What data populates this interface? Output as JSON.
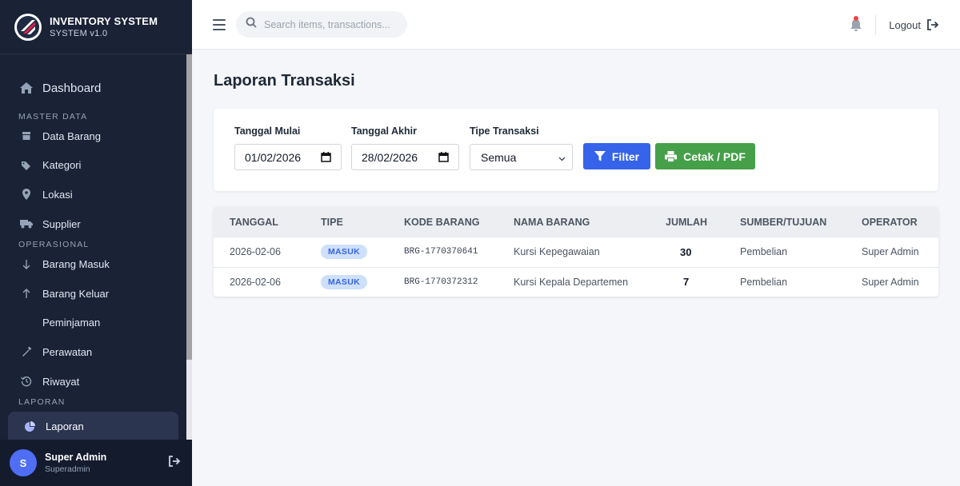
{
  "brand": {
    "title": "INVENTORY SYSTEM",
    "subtitle": "SYSTEM v1.0"
  },
  "sidebar": {
    "dashboard": "Dashboard",
    "section_master": "MASTER DATA",
    "master_items": [
      "Data Barang",
      "Kategori",
      "Lokasi",
      "Supplier"
    ],
    "section_operasional": "OPERASIONAL",
    "operasional_items": [
      "Barang Masuk",
      "Barang Keluar",
      "Peminjaman",
      "Perawatan",
      "Riwayat"
    ],
    "section_laporan": "LAPORAN",
    "active_item": "Laporan"
  },
  "user": {
    "initial": "S",
    "name": "Super Admin",
    "role": "Superadmin"
  },
  "topbar": {
    "search_placeholder": "Search items, transactions...",
    "logout_label": "Logout"
  },
  "page": {
    "title": "Laporan Transaksi"
  },
  "filter": {
    "start_label": "Tanggal Mulai",
    "start_value": "01/02/2026",
    "end_label": "Tanggal Akhir",
    "end_value": "28/02/2026",
    "type_label": "Tipe Transaksi",
    "type_value": "Semua",
    "filter_button": "Filter",
    "print_button": "Cetak / PDF"
  },
  "table": {
    "headers": [
      "TANGGAL",
      "TIPE",
      "KODE BARANG",
      "NAMA BARANG",
      "JUMLAH",
      "SUMBER/TUJUAN",
      "OPERATOR"
    ],
    "rows": [
      {
        "tanggal": "2026-02-06",
        "tipe": "MASUK",
        "kode": "BRG-1770370641",
        "nama": "Kursi Kepegawaian",
        "jumlah": "30",
        "sumber": "Pembelian",
        "operator": "Super Admin"
      },
      {
        "tanggal": "2026-02-06",
        "tipe": "MASUK",
        "kode": "BRG-1770372312",
        "nama": "Kursi Kepala Departemen",
        "jumlah": "7",
        "sumber": "Pembelian",
        "operator": "Super Admin"
      }
    ]
  },
  "colors": {
    "sidebar_bg": "#1a2236",
    "primary": "#3563e9",
    "success": "#45a049",
    "badge_bg": "#cfe0fb",
    "notification": "#ef4444"
  }
}
